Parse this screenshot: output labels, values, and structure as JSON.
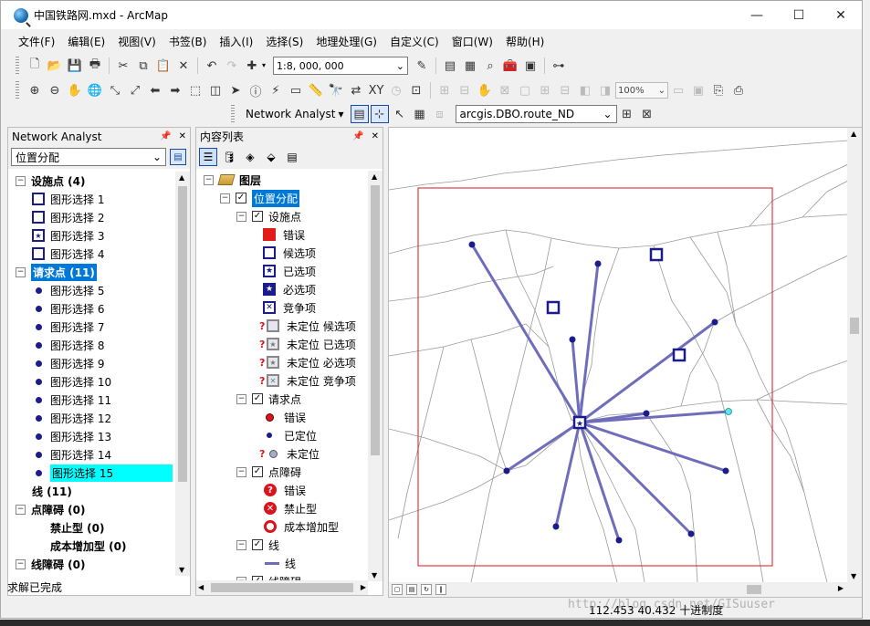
{
  "window": {
    "title": "中国铁路网.mxd - ArcMap",
    "controls": [
      "—",
      "☐",
      "✕"
    ]
  },
  "menu": [
    "文件(F)",
    "编辑(E)",
    "视图(V)",
    "书签(B)",
    "插入(I)",
    "选择(S)",
    "地理处理(G)",
    "自定义(C)",
    "窗口(W)",
    "帮助(H)"
  ],
  "toolbar": {
    "scale": "1:8, 000, 000",
    "zoom": "100%",
    "network_analyst_label": "Network Analyst",
    "network_dataset": "arcgis.DBO.route_ND"
  },
  "na_panel": {
    "title": "Network Analyst",
    "layer_select": "位置分配",
    "groups": [
      {
        "label": "设施点 (4)",
        "items": [
          "图形选择 1",
          "图形选择 2",
          "图形选择 3",
          "图形选择 4"
        ]
      },
      {
        "label": "请求点 (11)",
        "items": [
          "图形选择 5",
          "图形选择 6",
          "图形选择 7",
          "图形选择 8",
          "图形选择 9",
          "图形选择 10",
          "图形选择 11",
          "图形选择 12",
          "图形选择 13",
          "图形选择 14",
          "图形选择 15"
        ]
      },
      {
        "label": "线 (11)"
      },
      {
        "label": "点障碍 (0)",
        "items": [
          "禁止型 (0)",
          "成本增加型 (0)"
        ]
      },
      {
        "label": "线障碍 (0)"
      }
    ],
    "status": "求解已完成"
  },
  "toc_panel": {
    "title": "内容列表",
    "root": "图层",
    "layer": "位置分配",
    "facilities": {
      "label": "设施点",
      "symbols": [
        "错误",
        "候选项",
        "已选项",
        "必选项",
        "竞争项",
        "未定位 候选项",
        "未定位 已选项",
        "未定位 必选项",
        "未定位 竞争项"
      ]
    },
    "demand": {
      "label": "请求点",
      "symbols": [
        "错误",
        "已定位",
        "未定位"
      ]
    },
    "point_barriers": {
      "label": "点障碍",
      "symbols": [
        "错误",
        "禁止型",
        "成本增加型"
      ]
    },
    "lines": {
      "label": "线",
      "symbols": [
        "线"
      ]
    },
    "line_barriers": {
      "label": "线障碍"
    }
  },
  "status": {
    "coordinates": "112.453  40.432 十进制度",
    "watermark": "http://blog.csdn.net/GISuuser"
  },
  "colors": {
    "selection": "#0078d7",
    "highlight": "#00ffff",
    "facility": "#1b1b8a",
    "allocation_line": "#6d6dbb",
    "extent_box": "#d9141c"
  }
}
